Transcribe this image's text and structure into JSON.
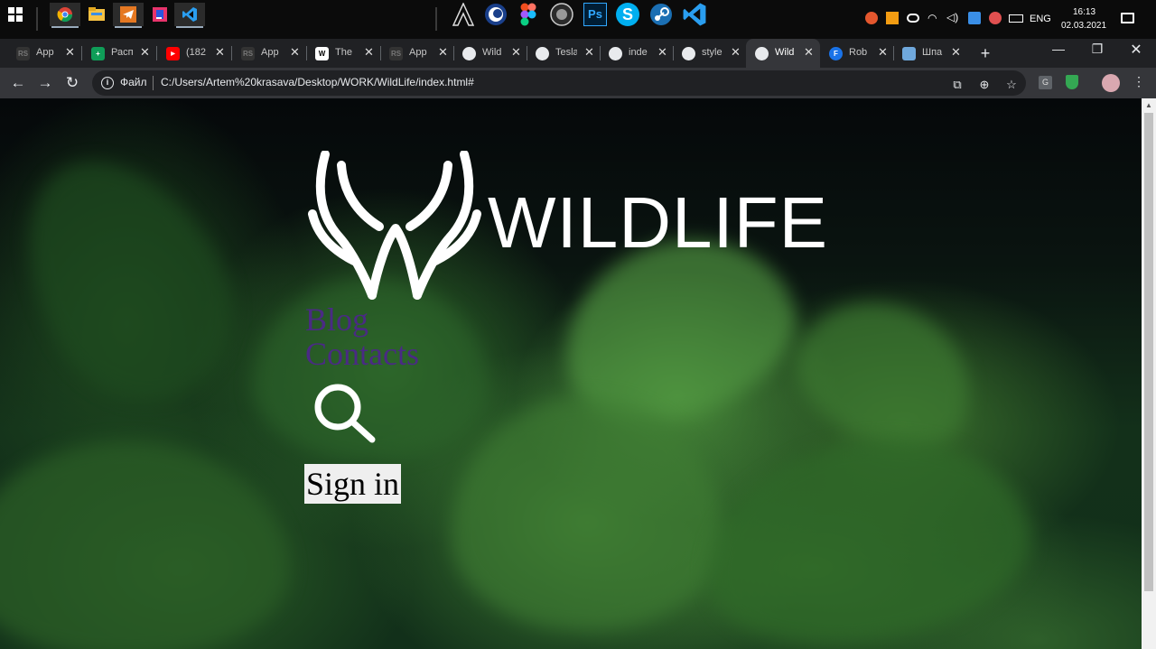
{
  "taskbar": {
    "pinned_left": [
      "windows-start-icon",
      "chrome-icon",
      "file-explorer-icon",
      "telegram-icon",
      "jetbrains-icon",
      "vscode-icon"
    ],
    "pinned_center": [
      "assassins-creed-icon",
      "cinema4d-icon",
      "figma-icon",
      "obs-icon",
      "photoshop-icon",
      "skype-icon",
      "steam-icon",
      "vscode-icon"
    ],
    "photoshop_label": "Ps",
    "skype_label": "S",
    "lang": "ENG",
    "time": "16:13",
    "date": "02.03.2021"
  },
  "tabs": [
    {
      "title": "App",
      "favicon_text": "RS",
      "favicon_color": "#333333"
    },
    {
      "title": "Расп",
      "favicon_text": "+",
      "favicon_color": "#0f9d58"
    },
    {
      "title": "(182",
      "favicon_text": "▶",
      "favicon_color": "#ff0000"
    },
    {
      "title": "App",
      "favicon_text": "RS",
      "favicon_color": "#333333"
    },
    {
      "title": "The",
      "favicon_text": "W",
      "favicon_color": "#ffffff"
    },
    {
      "title": "App",
      "favicon_text": "RS",
      "favicon_color": "#333333"
    },
    {
      "title": "Wild",
      "favicon_text": "",
      "favicon_color": "#e8eaed"
    },
    {
      "title": "Tesla",
      "favicon_text": "",
      "favicon_color": "#e8eaed"
    },
    {
      "title": "inde",
      "favicon_text": "",
      "favicon_color": "#e8eaed"
    },
    {
      "title": "style",
      "favicon_text": "",
      "favicon_color": "#e8eaed"
    },
    {
      "title": "Wild",
      "favicon_text": "",
      "favicon_color": "#e8eaed",
      "active": true
    },
    {
      "title": "Rob",
      "favicon_text": "F",
      "favicon_color": "#1a73e8"
    },
    {
      "title": "Шпа",
      "favicon_text": "",
      "favicon_color": "#6fa8dc"
    }
  ],
  "browser": {
    "new_tab": "+",
    "scheme_label": "Файл",
    "url": "C:/Users/Artem%20krasava/Desktop/WORK/WildLife/index.html#"
  },
  "page": {
    "logo_text": "WILDLIFE",
    "nav": [
      "Blog",
      "Contacts"
    ],
    "signin_label": "Sign in"
  }
}
